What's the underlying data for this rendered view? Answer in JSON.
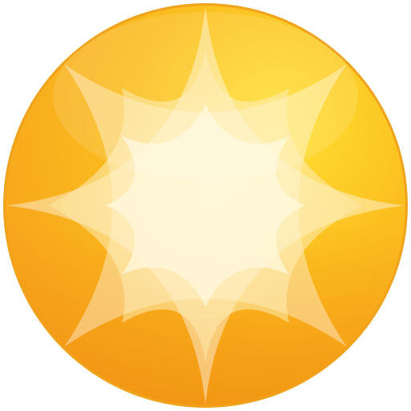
{
  "icon": {
    "name": "sun-icon",
    "colors": {
      "rim": "#f0a21a",
      "outer_dark": "#f7a21b",
      "outer_mid": "#fbbf1f",
      "outer_light": "#ffe234",
      "star_outer": "#fde9a6",
      "star_inner": "#fff6d4",
      "highlight": "#ffffff",
      "background": "#ffffff"
    }
  }
}
